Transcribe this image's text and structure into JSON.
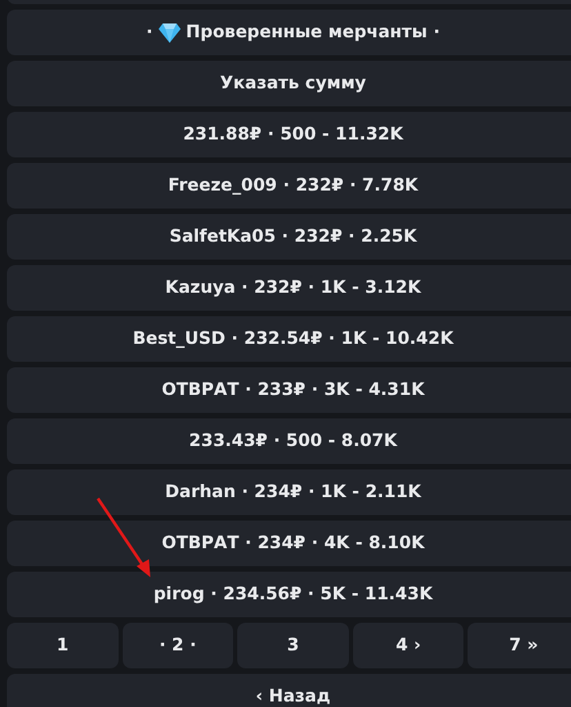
{
  "header_button": {
    "prefix": "·",
    "label": "Проверенные мерчанты ·"
  },
  "amount_button": {
    "label": "Указать сумму"
  },
  "merchants": [
    {
      "label": "231.88₽ · 500 - 11.32K"
    },
    {
      "label": "Freeze_009 · 232₽ · 7.78K"
    },
    {
      "label": "SalfetKa05 · 232₽ · 2.25K"
    },
    {
      "label": "Kazuya · 232₽ · 1K - 3.12K"
    },
    {
      "label": "Best_USD · 232.54₽ · 1K - 10.42K"
    },
    {
      "label": "ОТВРАТ · 233₽ · 3K - 4.31K"
    },
    {
      "label": "233.43₽ · 500 - 8.07K"
    },
    {
      "label": "Darhan · 234₽ · 1K - 2.11K"
    },
    {
      "label": "ОТВРАТ · 234₽ · 4K - 8.10K"
    },
    {
      "label": "pirog · 234.56₽ · 5K - 11.43K"
    }
  ],
  "pagination": [
    {
      "label": "1"
    },
    {
      "label": "· 2 ·"
    },
    {
      "label": "3"
    },
    {
      "label": "4 ›"
    },
    {
      "label": "7 »"
    }
  ],
  "back_button": {
    "label": "‹ Назад"
  }
}
